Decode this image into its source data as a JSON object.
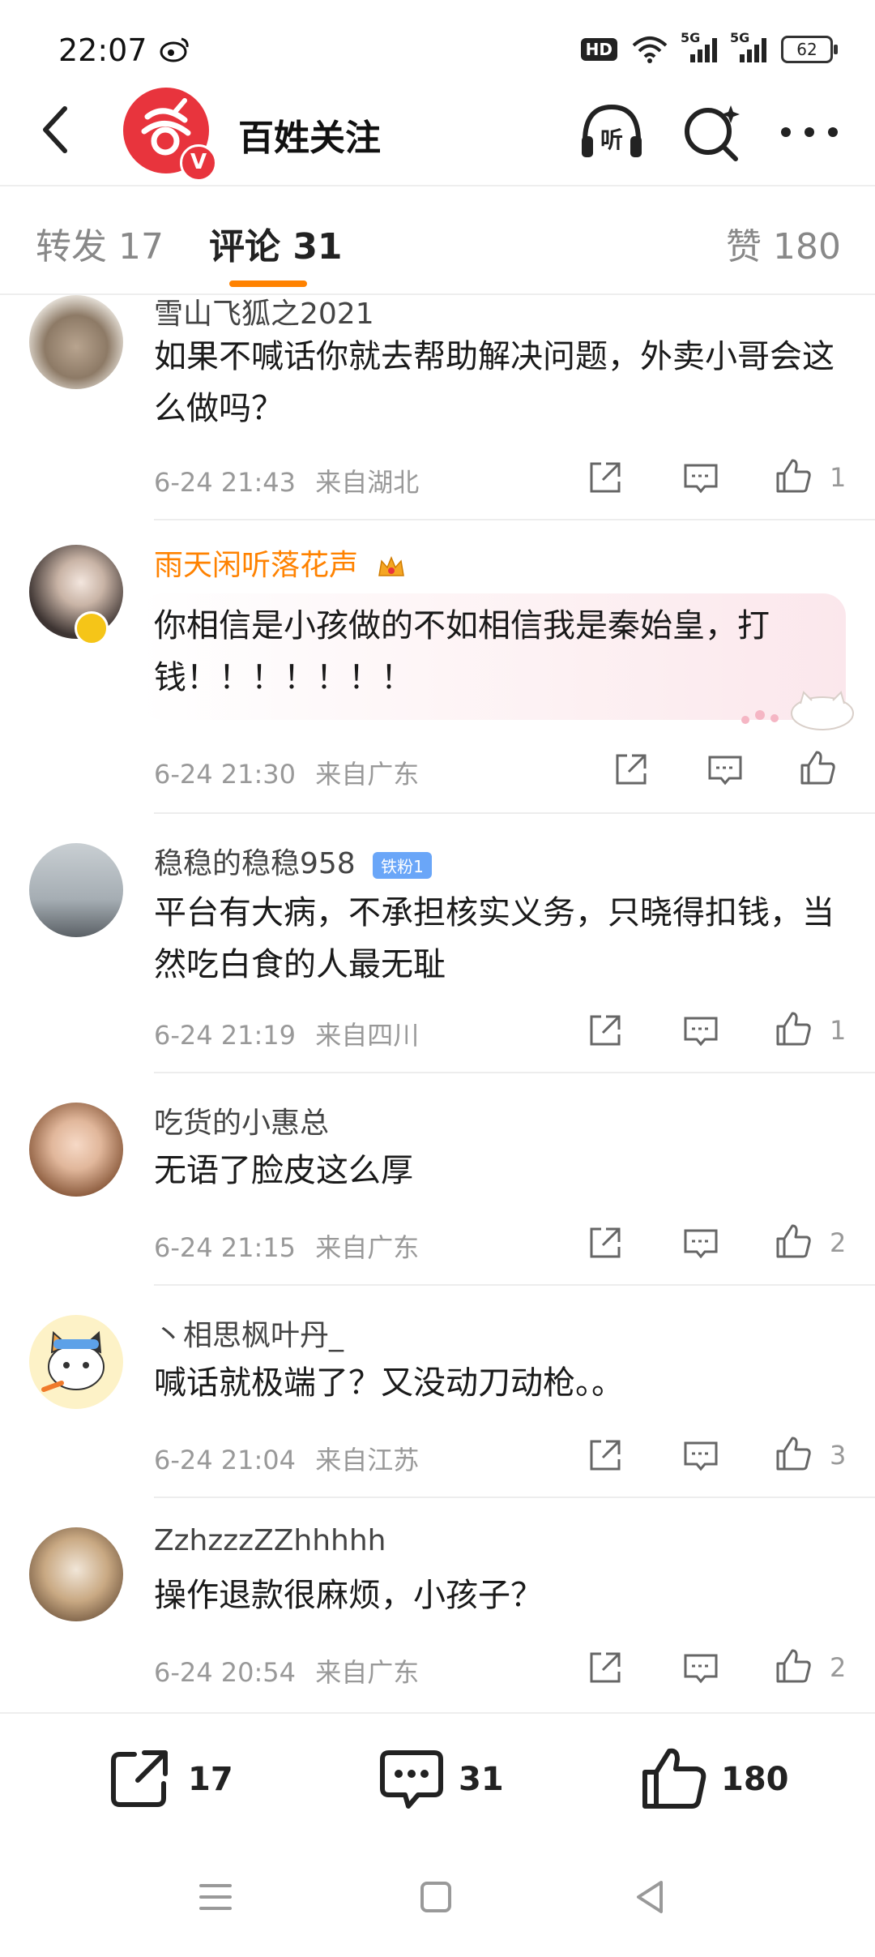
{
  "status_bar": {
    "time": "22:07",
    "hd_label": "HD",
    "network_label_1": "5G",
    "network_label_2": "5G",
    "battery_level": "62",
    "icons": [
      "weibo-icon",
      "hd-icon",
      "wifi-icon",
      "signal-icon",
      "battery-icon"
    ]
  },
  "header": {
    "account_name": "百姓关注",
    "verified_badge": "V",
    "icons": [
      "back-icon",
      "listen-icon",
      "search-icon",
      "more-icon"
    ]
  },
  "tabs": [
    {
      "label": "转发 17"
    },
    {
      "label": "评论 31"
    },
    {
      "label": "赞 180"
    }
  ],
  "accent_color": "#ff8200",
  "comments": [
    {
      "user": "雪山飞狐之2021",
      "text": "如果不喊话你就去帮助解决问题，外卖小哥会这么做吗？",
      "time": "6-24 21:43",
      "location": "来自湖北",
      "likes": "1"
    },
    {
      "user": "雨天闲听落花声",
      "text": "你相信是小孩做的不如相信我是秦始皇，打钱！！！！！！！",
      "time": "6-24 21:30",
      "location": "来自广东",
      "likes": ""
    },
    {
      "user": "稳稳的稳稳958",
      "badge": "铁粉1",
      "text": "平台有大病，不承担核实义务，只晓得扣钱，当然吃白食的人最无耻",
      "time": "6-24 21:19",
      "location": "来自四川",
      "likes": "1"
    },
    {
      "user": "吃货的小惠总",
      "text": "无语了脸皮这么厚",
      "time": "6-24 21:15",
      "location": "来自广东",
      "likes": "2"
    },
    {
      "user": "丶相思枫叶丹_",
      "text": "喊话就极端了？又没动刀动枪。。",
      "time": "6-24 21:04",
      "location": "来自江苏",
      "likes": "3"
    },
    {
      "user": "ZzhzzzZZhhhhh",
      "text": "操作退款很麻烦，小孩子？",
      "time": "6-24 20:54",
      "location": "来自广东",
      "likes": "2"
    }
  ],
  "bottom_bar": {
    "repost_count": "17",
    "comment_count": "31",
    "like_count": "180"
  }
}
